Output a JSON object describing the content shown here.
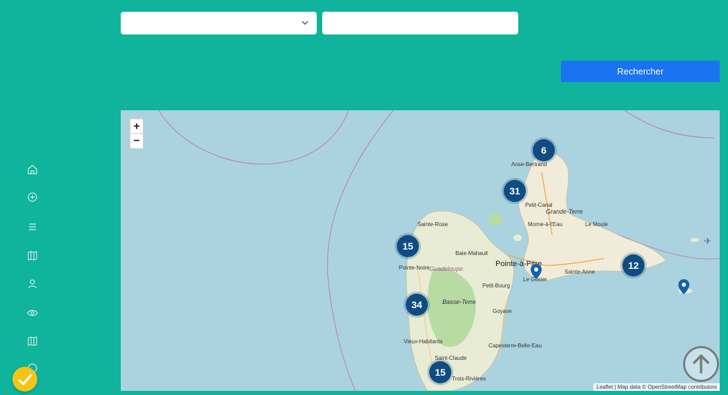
{
  "filters": {
    "select_value": "",
    "text_input_value": "",
    "text_input_placeholder": "",
    "search_button_label": "Rechercher"
  },
  "sidebar": {
    "items": [
      {
        "icon": "home-icon"
      },
      {
        "icon": "add-circle-icon"
      },
      {
        "icon": "list-icon"
      },
      {
        "icon": "map-icon"
      },
      {
        "icon": "user-icon"
      },
      {
        "icon": "eye-icon"
      },
      {
        "icon": "map-icon"
      },
      {
        "icon": "circle-icon"
      }
    ],
    "fab_icon": "checkmark-icon"
  },
  "map": {
    "zoom_in_label": "+",
    "zoom_out_label": "−",
    "clusters": [
      {
        "count": "6"
      },
      {
        "count": "31"
      },
      {
        "count": "15"
      },
      {
        "count": "12"
      },
      {
        "count": "34"
      },
      {
        "count": "15"
      }
    ],
    "places": {
      "anse_bertrand": "Anse-Bertrand",
      "petit_canal": "Petit-Canal",
      "grande_terre": "Grande-Terre",
      "morne_a_leau": "Morne-à-l'Eau",
      "le_moule": "Le Moule",
      "sainte_rose": "Sainte-Rose",
      "baie_mahault": "Baie-Mahault",
      "pointe_a_pitre": "Pointe-à-Pitre",
      "pointe_noire": "Pointe-Noire",
      "guadeloupe": "Guadeloupe",
      "le_gosier": "Le Gosier",
      "sainte_anne": "Sainte-Anne",
      "petit_bourg": "Petit-Bourg",
      "basse_terre": "Basse-Terre",
      "goyave": "Goyave",
      "vieux_habitants": "Vieux-Habitants",
      "capesterre": "Capesterre-Belle-Eau",
      "saint_claude": "Saint-Claude",
      "trois_rivieres": "Trois-Rivières"
    },
    "attribution": "Leaflet | Map data © OpenStreetMap contributors"
  },
  "colors": {
    "background": "#10b39c",
    "button": "#1a73f0",
    "cluster": "#0f4c81",
    "fab": "#f4c417"
  }
}
